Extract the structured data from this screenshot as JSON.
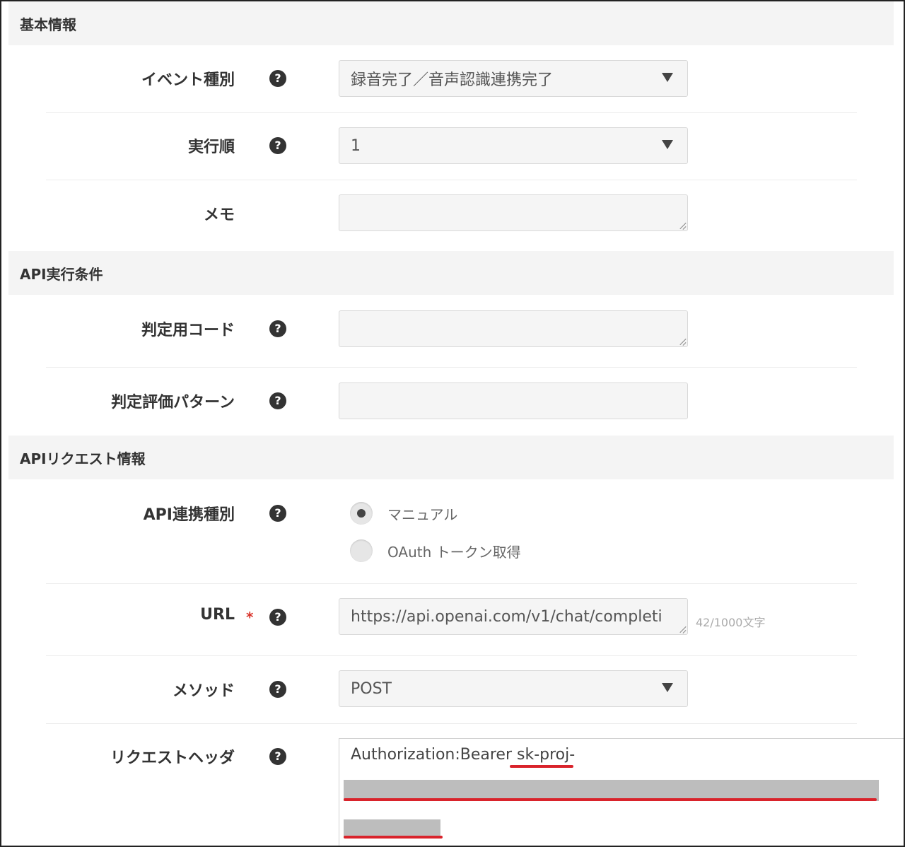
{
  "sections": {
    "basic": "基本情報",
    "api_condition": "API実行条件",
    "api_request": "APIリクエスト情報"
  },
  "fields": {
    "event_type": {
      "label": "イベント種別",
      "value": "録音完了／音声認識連携完了"
    },
    "exec_order": {
      "label": "実行順",
      "value": "1"
    },
    "memo": {
      "label": "メモ",
      "value": ""
    },
    "judge_code": {
      "label": "判定用コード",
      "value": ""
    },
    "judge_pattern": {
      "label": "判定評価パターン",
      "value": ""
    },
    "api_type": {
      "label": "API連携種別",
      "options": [
        "マニュアル",
        "OAuth トークン取得"
      ],
      "selected": "マニュアル"
    },
    "url": {
      "label": "URL",
      "required_mark": "*",
      "value": "https://api.openai.com/v1/chat/completi",
      "counter": "42/1000文字"
    },
    "method": {
      "label": "メソッド",
      "value": "POST"
    },
    "request_header": {
      "label": "リクエストヘッダ",
      "value": "Authorization:Bearer sk-proj-"
    }
  },
  "icons": {
    "help": "?"
  },
  "colors": {
    "required": "#d9342b",
    "highlight_underline": "#d9232b",
    "redaction": "#bdbdbd"
  }
}
